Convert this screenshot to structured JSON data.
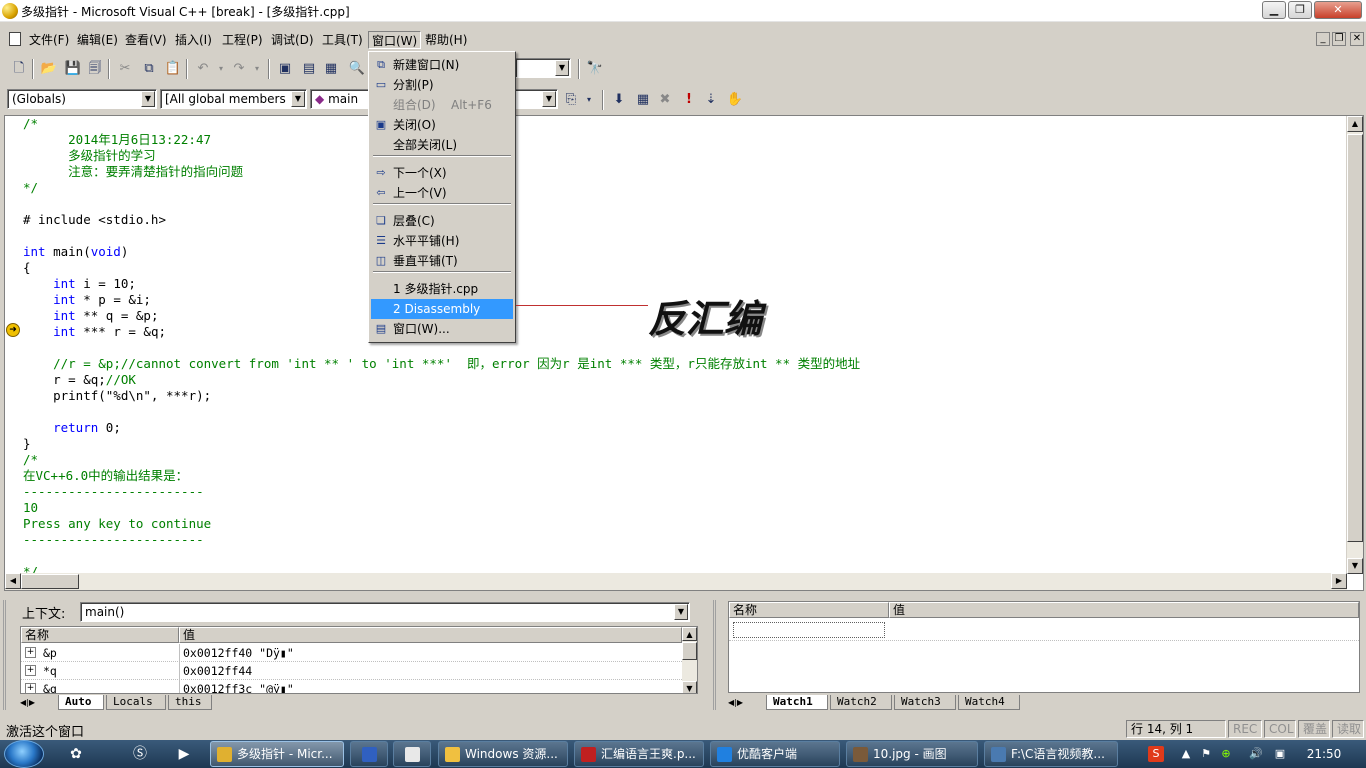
{
  "window": {
    "title": "多级指针 - Microsoft Visual C++ [break] - [多级指针.cpp]"
  },
  "menubar": {
    "items": [
      "文件(F)",
      "编辑(E)",
      "查看(V)",
      "插入(I)",
      "工程(P)",
      "调试(D)",
      "工具(T)",
      "窗口(W)",
      "帮助(H)"
    ]
  },
  "toolbar": {
    "scope_combo": "(Globals)",
    "members_combo": "[All global members",
    "function_combo": "main"
  },
  "window_menu": {
    "items": [
      {
        "label": "新建窗口(N)",
        "icon": "new-window-icon"
      },
      {
        "label": "分割(P)",
        "icon": "split-icon"
      },
      {
        "label": "组合(D)",
        "shortcut": "Alt+F6",
        "disabled": true
      },
      {
        "label": "关闭(O)",
        "icon": "close-window-icon"
      },
      {
        "label": "全部关闭(L)"
      },
      {
        "label": "下一个(X)",
        "icon": "next-window-icon"
      },
      {
        "label": "上一个(V)",
        "icon": "prev-window-icon"
      },
      {
        "label": "层叠(C)",
        "icon": "cascade-icon"
      },
      {
        "label": "水平平铺(H)",
        "icon": "tile-horizontal-icon"
      },
      {
        "label": "垂直平铺(T)",
        "icon": "tile-vertical-icon"
      },
      {
        "label": "1 多级指针.cpp"
      },
      {
        "label": "2 Disassembly",
        "selected": true
      },
      {
        "label": "窗口(W)...",
        "icon": "windows-list-icon"
      }
    ]
  },
  "annotation": {
    "text": "反汇编"
  },
  "code": {
    "lines": [
      "/*",
      "      2014年1月6日13:22:47",
      "      多级指针的学习",
      "      注意：要弄清楚指针的指向问题",
      "*/",
      "",
      "# include <stdio.h>",
      "",
      "int main(void)",
      "{",
      "    int i = 10;",
      "    int * p = &i;",
      "    int ** q = &p;",
      "    int *** r = &q;",
      "",
      "    //r = &p;//cannot convert from 'int ** ' to 'int ***'  即，error 因为r 是int *** 类型，r只能存放int ** 类型的地址",
      "    r = &q;//OK",
      "    printf(\"%d\\n\", ***r);",
      "",
      "    return 0;",
      "}",
      "/*",
      "在VC++6.0中的输出结果是：",
      "------------------------",
      "10",
      "Press any key to continue",
      "------------------------",
      "",
      "*/"
    ]
  },
  "variables": {
    "context_label": "上下文:",
    "context_value": "main()",
    "col_name": "名称",
    "col_value": "值",
    "rows": [
      {
        "name": "&p",
        "value": "0x0012ff40 \"Dÿ▮\""
      },
      {
        "name": "*q",
        "value": "0x0012ff44"
      },
      {
        "name": "&q",
        "value": "0x0012ff3c \"@ÿ▮\""
      }
    ],
    "tabs": [
      "Auto",
      "Locals",
      "this"
    ]
  },
  "watch": {
    "col_name": "名称",
    "col_value": "值",
    "tabs": [
      "Watch1",
      "Watch2",
      "Watch3",
      "Watch4"
    ]
  },
  "statusbar": {
    "message": "激活这个窗口",
    "position": "行 14, 列 1",
    "rec": "REC",
    "col": "COL",
    "ovr": "覆盖",
    "read": "读取"
  },
  "taskbar": {
    "buttons": [
      {
        "label": "多级指针 - Micr...",
        "active": true
      },
      {
        "label": ""
      },
      {
        "label": ""
      },
      {
        "label": "Windows 资源..."
      },
      {
        "label": "汇编语言王爽.p..."
      },
      {
        "label": "优酷客户端"
      },
      {
        "label": "10.jpg - 画图"
      },
      {
        "label": "F:\\C语言视频教..."
      }
    ],
    "clock": "21:50"
  }
}
